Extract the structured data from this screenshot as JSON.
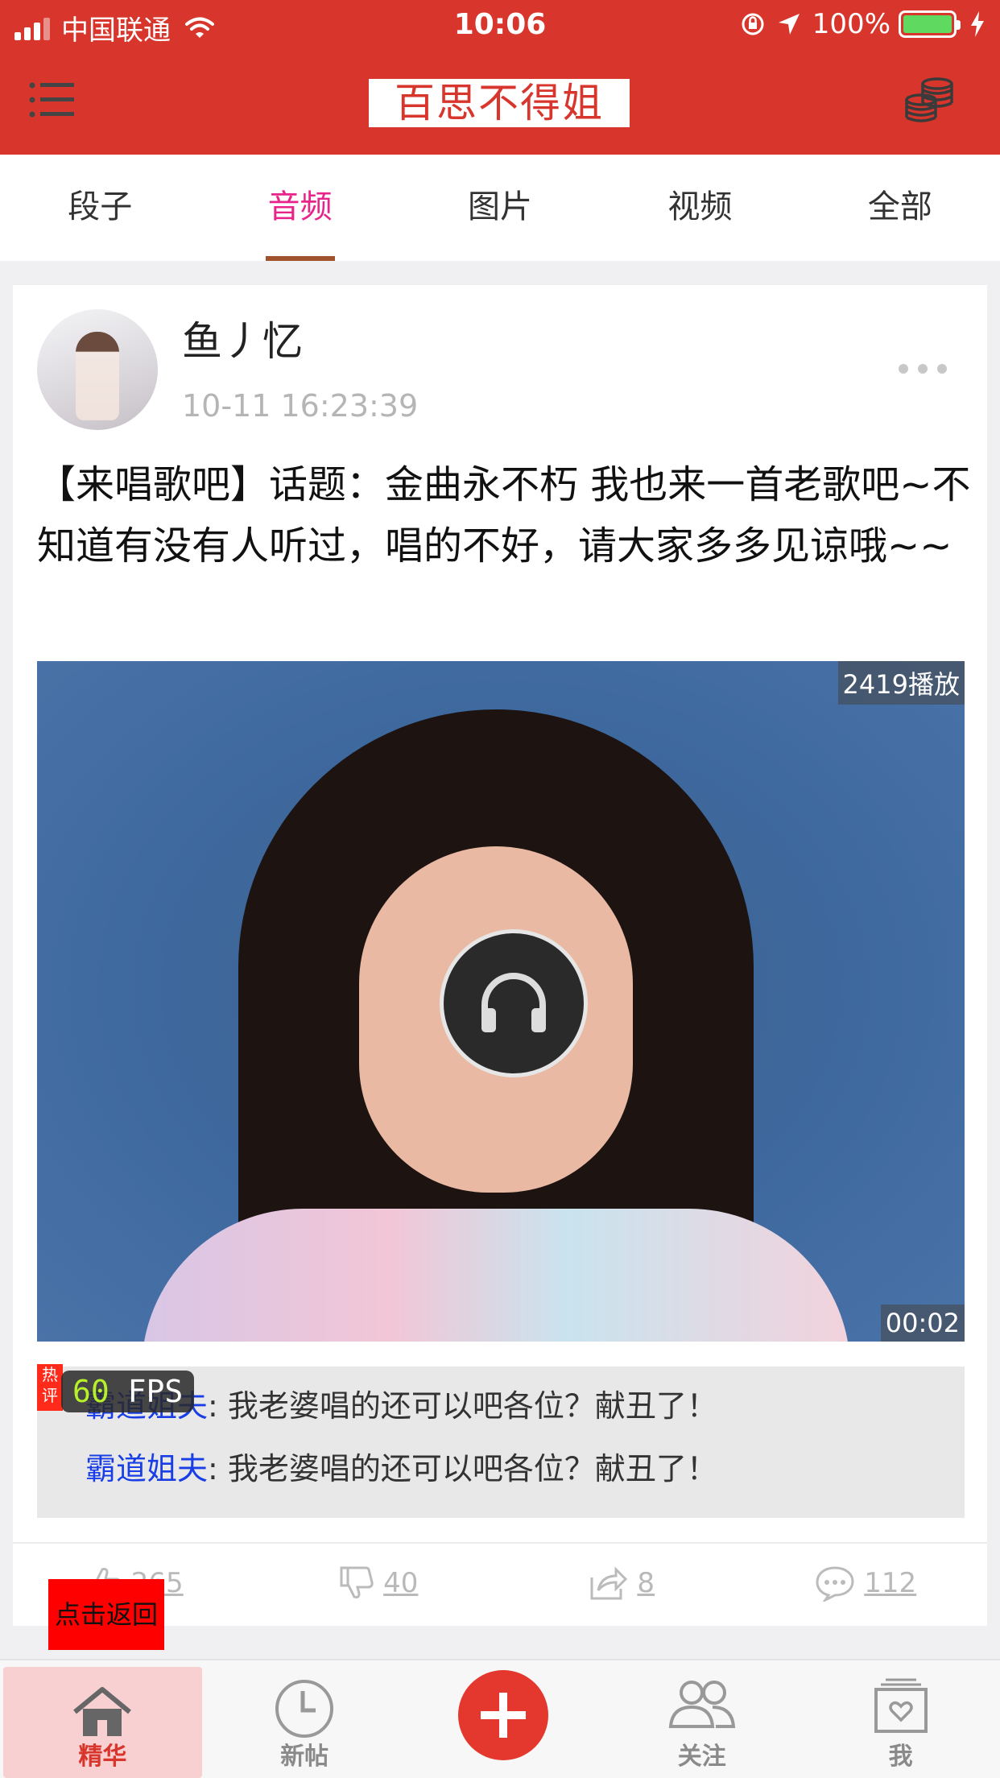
{
  "status_bar": {
    "carrier": "中国联通",
    "time": "10:06",
    "battery": "100%"
  },
  "header": {
    "logo_text": "百思不得姐"
  },
  "tabs": [
    {
      "label": "段子",
      "active": false
    },
    {
      "label": "音频",
      "active": true
    },
    {
      "label": "图片",
      "active": false
    },
    {
      "label": "视频",
      "active": false
    },
    {
      "label": "全部",
      "active": false
    }
  ],
  "post": {
    "username": "鱼丿忆",
    "time": "10-11 16:23:39",
    "content": "【来唱歌吧】话题：金曲永不朽 我也来一首老歌吧~不知道有没有人听过，唱的不好，请大家多多见谅哦~~",
    "play_count": "2419播放",
    "duration": "00:02",
    "hot_tag": "热评",
    "comments": [
      {
        "author": "霸道姐夫",
        "text": ": 我老婆唱的还可以吧各位？献丑了！"
      },
      {
        "author": "霸道姐夫",
        "text": ": 我老婆唱的还可以吧各位？献丑了！"
      }
    ],
    "actions": {
      "like_count": "265",
      "dislike_count": "40",
      "share_count": "8",
      "comment_count": "112"
    }
  },
  "overlay": {
    "fps_value": "60",
    "fps_unit": "FPS",
    "back_button": "点击返回"
  },
  "tabbar": [
    {
      "label": "精华",
      "icon": "home-icon",
      "active": true
    },
    {
      "label": "新帖",
      "icon": "clock-icon",
      "active": false
    },
    {
      "label": "",
      "icon": "plus-icon",
      "active": false
    },
    {
      "label": "关注",
      "icon": "people-icon",
      "active": false
    },
    {
      "label": "我",
      "icon": "profile-icon",
      "active": false
    }
  ],
  "colors": {
    "brand_red": "#d8362c",
    "active_tab": "#e8238a",
    "comment_author": "#1a3ee6"
  }
}
